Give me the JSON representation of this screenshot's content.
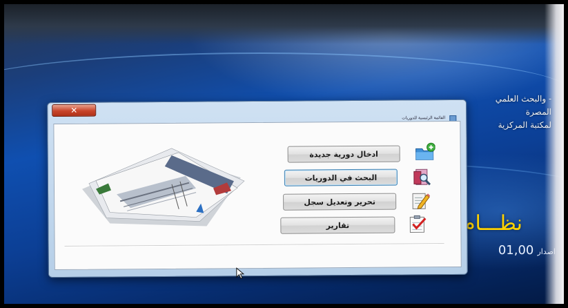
{
  "desktop": {
    "header_lines": [
      "- والبحث العلمي",
      "المصرة",
      "لمكتبة المركزية"
    ],
    "system_title": "نظـــام",
    "version_label": "اصدار",
    "version_number": "01,00"
  },
  "window": {
    "title": "القائمة الرئيسية للدوريات",
    "close_glyph": "✕"
  },
  "menu": {
    "new_periodical": "ادخال دورية جديدة",
    "search_periodicals": "البحث في الدوريات",
    "edit_record": "تحرير وتعديل سجل",
    "reports": "تقارير"
  },
  "icons": {
    "new_periodical": "folder-add-icon",
    "search_periodicals": "search-folder-icon",
    "edit_record": "edit-pencil-icon",
    "reports": "checklist-icon",
    "decoration": "newspapers-icon"
  },
  "colors": {
    "title_yellow": "#ffd200",
    "close_red": "#c8442a"
  }
}
